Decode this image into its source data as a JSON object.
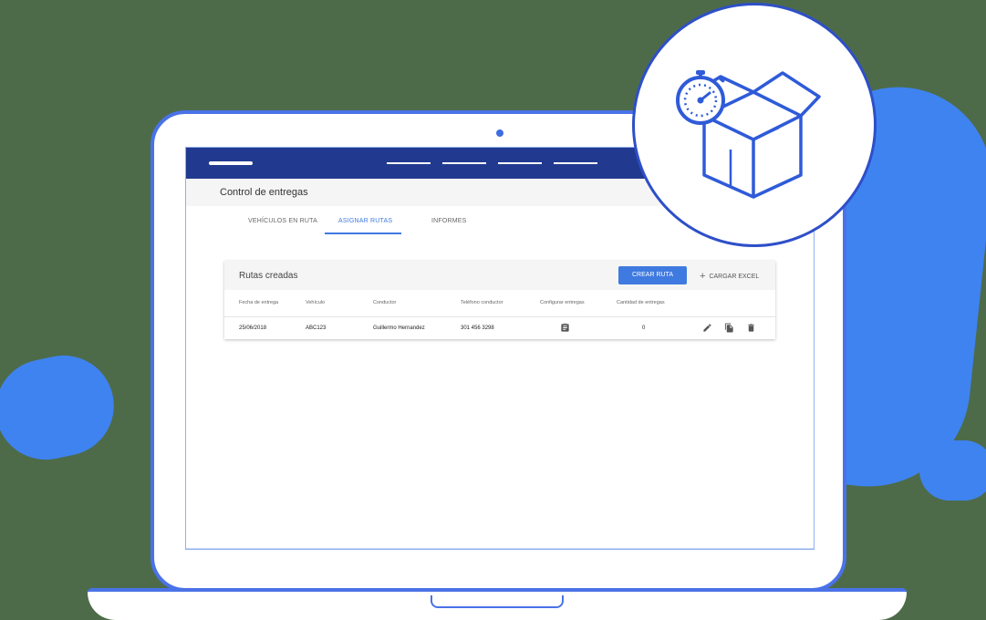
{
  "colors": {
    "accent": "#3f7ae0",
    "topbar": "#213a8f",
    "blob": "#3f83f0",
    "laptop_outline": "#4a72e8"
  },
  "header": {
    "page_title": "Control de entregas"
  },
  "tabs": [
    {
      "label": "VEHÍCULOS EN RUTA",
      "active": false
    },
    {
      "label": "ASIGNAR RUTAS",
      "active": true
    },
    {
      "label": "INFORMES",
      "active": false
    }
  ],
  "card": {
    "title": "Rutas creadas",
    "create_button": "CREAR RUTA",
    "upload_button": "CARGAR EXCEL",
    "upload_icon": "plus-icon"
  },
  "table": {
    "columns": [
      "Fecha de entrega",
      "Vehículo",
      "Conductor",
      "Teléfono conductor",
      "Configurar entregas",
      "Cantidad de entregas"
    ],
    "rows": [
      {
        "fecha": "25/06/2018",
        "vehiculo": "ABC123",
        "conductor": "Guillermo Hernandez",
        "telefono": "301 456 3298",
        "configurar_icon": "clipboard-icon",
        "cantidad": "0",
        "actions": [
          "edit-icon",
          "copy-icon",
          "delete-icon"
        ]
      }
    ]
  },
  "badge": {
    "icons": [
      "stopwatch-icon",
      "open-box-icon"
    ]
  }
}
